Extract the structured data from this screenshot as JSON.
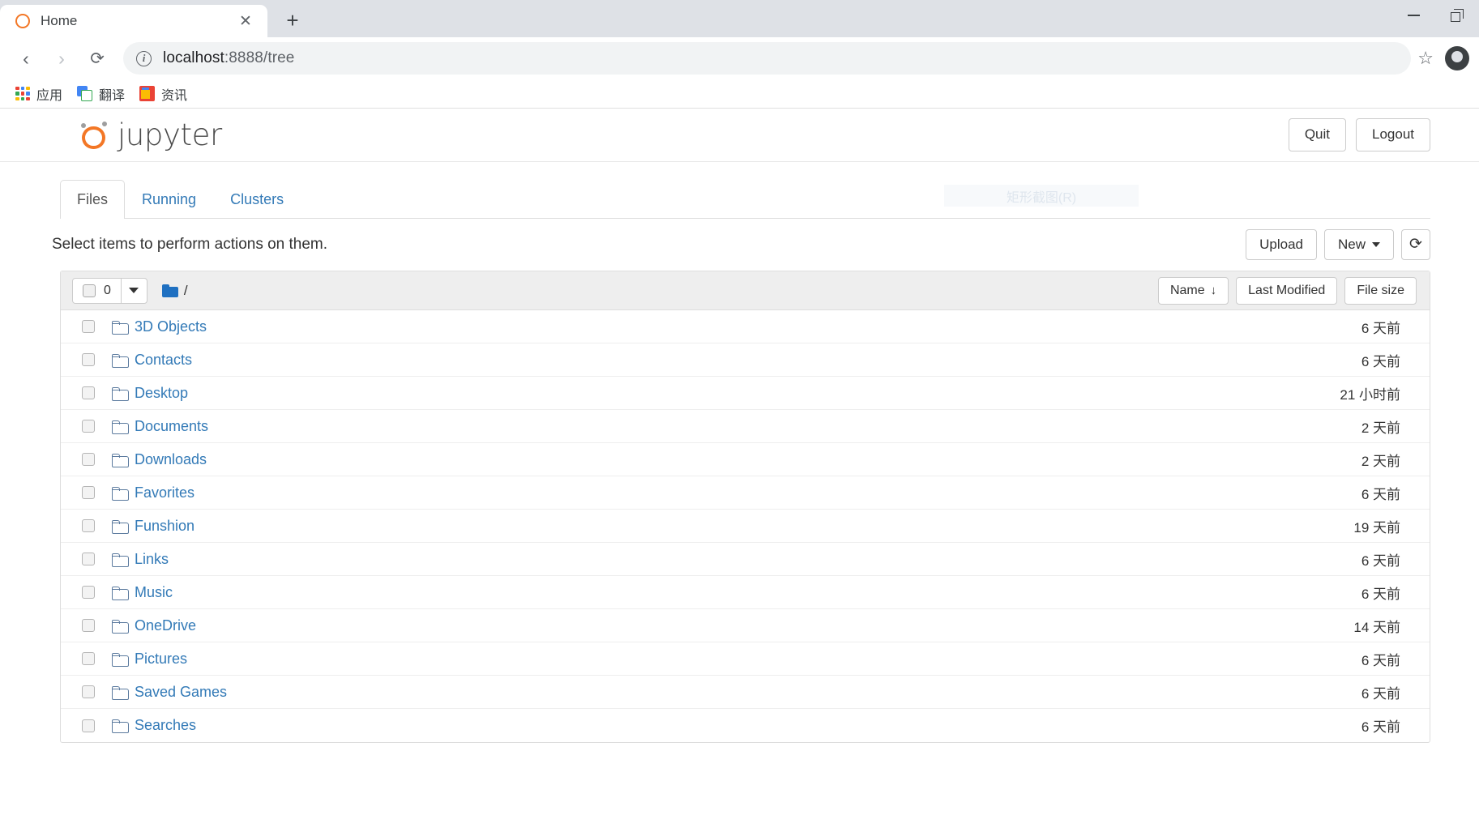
{
  "browser": {
    "tab": {
      "title": "Home",
      "favicon": "jupyter-icon",
      "close_label": "✕"
    },
    "new_tab_label": "+",
    "window_controls": {
      "minimize": "minimize-icon",
      "restore": "restore-icon"
    },
    "nav": {
      "back": "‹",
      "forward": "›",
      "reload": "⟳"
    },
    "omnibox": {
      "info_icon": "i",
      "url_host": "localhost",
      "url_path": ":8888/tree",
      "star": "☆"
    },
    "bookmarks": [
      {
        "label": "应用",
        "icon": "apps-grid-icon"
      },
      {
        "label": "翻译",
        "icon": "google-translate-icon"
      },
      {
        "label": "资讯",
        "icon": "google-news-icon"
      }
    ]
  },
  "jupyter": {
    "logo_text": "jupyter",
    "header_buttons": [
      {
        "label": "Quit",
        "name": "quit-button"
      },
      {
        "label": "Logout",
        "name": "logout-button"
      }
    ],
    "tabs": [
      {
        "label": "Files",
        "active": true
      },
      {
        "label": "Running",
        "active": false
      },
      {
        "label": "Clusters",
        "active": false
      }
    ],
    "screenshot_overlay": "矩形截图(R)",
    "hint": "Select items to perform actions on them.",
    "actions": {
      "upload": "Upload",
      "new": "New",
      "refresh": "⟳"
    },
    "list_header": {
      "selected_count": "0",
      "breadcrumb_root": "/",
      "sort_name": "Name",
      "sort_name_arrow": "↓",
      "sort_modified": "Last Modified",
      "sort_filesize": "File size"
    },
    "files": [
      {
        "name": "3D Objects",
        "type": "folder",
        "modified": "6 天前"
      },
      {
        "name": "Contacts",
        "type": "folder",
        "modified": "6 天前"
      },
      {
        "name": "Desktop",
        "type": "folder",
        "modified": "21 小时前"
      },
      {
        "name": "Documents",
        "type": "folder",
        "modified": "2 天前"
      },
      {
        "name": "Downloads",
        "type": "folder",
        "modified": "2 天前"
      },
      {
        "name": "Favorites",
        "type": "folder",
        "modified": "6 天前"
      },
      {
        "name": "Funshion",
        "type": "folder",
        "modified": "19 天前"
      },
      {
        "name": "Links",
        "type": "folder",
        "modified": "6 天前"
      },
      {
        "name": "Music",
        "type": "folder",
        "modified": "6 天前"
      },
      {
        "name": "OneDrive",
        "type": "folder",
        "modified": "14 天前"
      },
      {
        "name": "Pictures",
        "type": "folder",
        "modified": "6 天前"
      },
      {
        "name": "Saved Games",
        "type": "folder",
        "modified": "6 天前"
      },
      {
        "name": "Searches",
        "type": "folder",
        "modified": "6 天前"
      }
    ]
  },
  "colors": {
    "jupyter_orange": "#f37726",
    "link_blue": "#337ab7",
    "chrome_tabstrip": "#dee1e6",
    "folder_blue": "#1f70c1",
    "header_gray": "#eeeeee"
  }
}
